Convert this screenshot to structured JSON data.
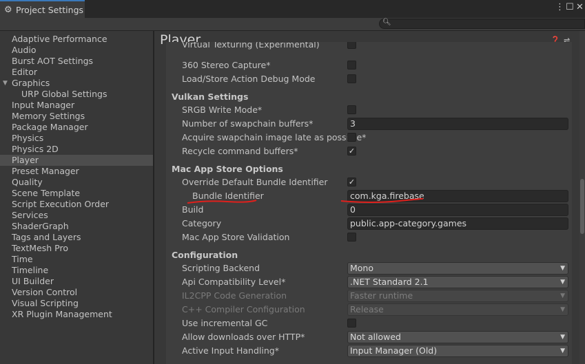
{
  "window": {
    "tab_label": "Project Settings",
    "tab_icon": "gear-icon",
    "controls": [
      "more-icon",
      "maximize-icon",
      "close-icon"
    ]
  },
  "search": {
    "placeholder": "",
    "value": ""
  },
  "sidebar": {
    "items": [
      {
        "label": "Adaptive Performance",
        "indent": 0
      },
      {
        "label": "Audio",
        "indent": 0
      },
      {
        "label": "Burst AOT Settings",
        "indent": 0
      },
      {
        "label": "Editor",
        "indent": 0
      },
      {
        "label": "Graphics",
        "indent": 0,
        "expanded": true
      },
      {
        "label": "URP Global Settings",
        "indent": 1
      },
      {
        "label": "Input Manager",
        "indent": 0
      },
      {
        "label": "Memory Settings",
        "indent": 0
      },
      {
        "label": "Package Manager",
        "indent": 0
      },
      {
        "label": "Physics",
        "indent": 0
      },
      {
        "label": "Physics 2D",
        "indent": 0
      },
      {
        "label": "Player",
        "indent": 0,
        "selected": true
      },
      {
        "label": "Preset Manager",
        "indent": 0
      },
      {
        "label": "Quality",
        "indent": 0
      },
      {
        "label": "Scene Template",
        "indent": 0
      },
      {
        "label": "Script Execution Order",
        "indent": 0
      },
      {
        "label": "Services",
        "indent": 0
      },
      {
        "label": "ShaderGraph",
        "indent": 0
      },
      {
        "label": "Tags and Layers",
        "indent": 0
      },
      {
        "label": "TextMesh Pro",
        "indent": 0
      },
      {
        "label": "Time",
        "indent": 0
      },
      {
        "label": "Timeline",
        "indent": 0
      },
      {
        "label": "UI Builder",
        "indent": 0
      },
      {
        "label": "Version Control",
        "indent": 0
      },
      {
        "label": "Visual Scripting",
        "indent": 0
      },
      {
        "label": "XR Plugin Management",
        "indent": 0
      }
    ]
  },
  "main": {
    "title": "Player",
    "header_icons": [
      "help-icon",
      "presets-icon",
      "more-icon"
    ],
    "rows": [
      {
        "kind": "checkbox",
        "label": "Virtual Texturing (Experimental)",
        "checked": false,
        "partial": true
      },
      {
        "kind": "checkbox",
        "label": "360 Stereo Capture*",
        "checked": false
      },
      {
        "kind": "checkbox",
        "label": "Load/Store Action Debug Mode",
        "checked": false
      },
      {
        "kind": "header",
        "label": "Vulkan Settings"
      },
      {
        "kind": "checkbox",
        "label": "SRGB Write Mode*",
        "checked": false
      },
      {
        "kind": "field",
        "label": "Number of swapchain buffers*",
        "value": "3"
      },
      {
        "kind": "checkbox",
        "label": "Acquire swapchain image late as possible*",
        "checked": false
      },
      {
        "kind": "checkbox",
        "label": "Recycle command buffers*",
        "checked": true
      },
      {
        "kind": "header",
        "label": "Mac App Store Options"
      },
      {
        "kind": "checkbox",
        "label": "Override Default Bundle Identifier",
        "checked": true
      },
      {
        "kind": "field",
        "label": "Bundle Identifier",
        "value": "com.kga.firebase",
        "indent_extra": true
      },
      {
        "kind": "field",
        "label": "Build",
        "value": "0"
      },
      {
        "kind": "field",
        "label": "Category",
        "value": "public.app-category.games"
      },
      {
        "kind": "checkbox",
        "label": "Mac App Store Validation",
        "checked": false
      },
      {
        "kind": "header",
        "label": "Configuration"
      },
      {
        "kind": "dropdown",
        "label": "Scripting Backend",
        "value": "Mono"
      },
      {
        "kind": "dropdown",
        "label": "Api Compatibility Level*",
        "value": ".NET Standard 2.1"
      },
      {
        "kind": "dropdown",
        "label": "IL2CPP Code Generation",
        "value": "Faster runtime",
        "disabled": true
      },
      {
        "kind": "dropdown",
        "label": "C++ Compiler Configuration",
        "value": "Release",
        "disabled": true
      },
      {
        "kind": "checkbox",
        "label": "Use incremental GC",
        "checked": false
      },
      {
        "kind": "dropdown",
        "label": "Allow downloads over HTTP*",
        "value": "Not allowed"
      },
      {
        "kind": "dropdown",
        "label": "Active Input Handling*",
        "value": "Input Manager (Old)"
      }
    ]
  },
  "colors": {
    "background": "#383838",
    "panel": "#3e3e3e",
    "selected": "#4d4d4d",
    "annotation": "#e0201c"
  }
}
